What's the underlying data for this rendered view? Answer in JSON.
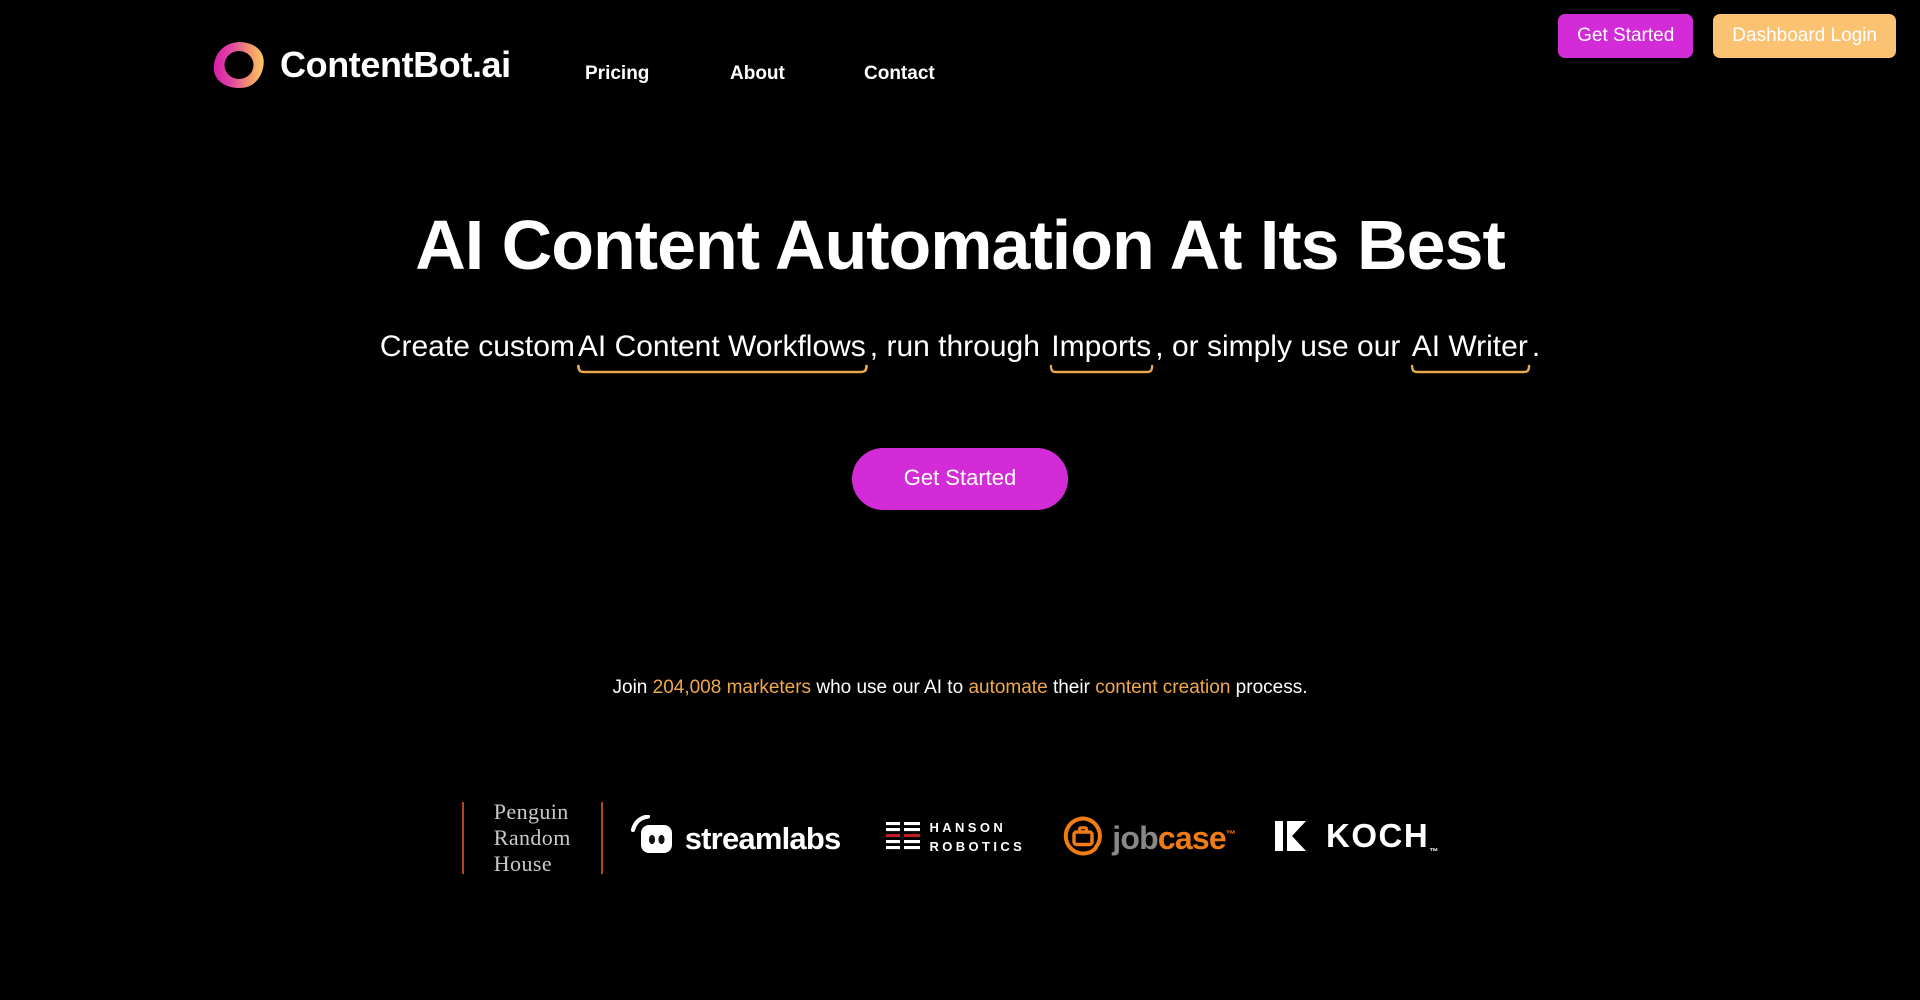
{
  "colors": {
    "background": "#000000",
    "magenta": "#d42bd8",
    "peach": "#fbc272",
    "accent_orange": "#f0a94b",
    "underline_orange": "#e8a84e",
    "rule_orange": "#b24a17",
    "text_white": "#ffffff",
    "prh_gray": "#c9c9c9",
    "jobcase_orange": "#f07d14",
    "jobcase_gray": "#888888",
    "hanson_red": "#c21f24"
  },
  "header": {
    "brand": {
      "name": "ContentBot.ai",
      "logo_icon": "gradient-ring-icon"
    },
    "nav": [
      {
        "label": "Pricing"
      },
      {
        "label": "About"
      },
      {
        "label": "Contact"
      }
    ],
    "actions": [
      {
        "label": "Get Started",
        "style": "magenta"
      },
      {
        "label": "Dashboard Login",
        "style": "peach"
      }
    ]
  },
  "hero": {
    "headline": "AI Content Automation At Its Best",
    "subhead": {
      "part1": "Create custom",
      "link1": "AI Content Workflows",
      "part2": ", run through ",
      "link2": "Imports",
      "part3": ", or simply use our ",
      "link3": "AI Writer",
      "part4": "."
    },
    "cta": {
      "label": "Get Started"
    },
    "social_proof": {
      "pre": "Join ",
      "count": "204,008 marketers",
      "mid1": " who use our AI to ",
      "verb": "automate",
      "mid2": " their ",
      "noun": "content creation",
      "post": " process."
    }
  },
  "logos": [
    {
      "name": "Penguin Random House",
      "line1": "Penguin",
      "line2": "Random",
      "line3": "House"
    },
    {
      "name": "Streamlabs",
      "wordmark": "streamlabs"
    },
    {
      "name": "Hanson Robotics",
      "line1": "HANSON",
      "line2": "ROBOTICS"
    },
    {
      "name": "Jobcase",
      "word_a": "job",
      "word_b": "case",
      "tm": "™"
    },
    {
      "name": "Koch",
      "wordmark": "KOCH",
      "tm": "™"
    }
  ]
}
